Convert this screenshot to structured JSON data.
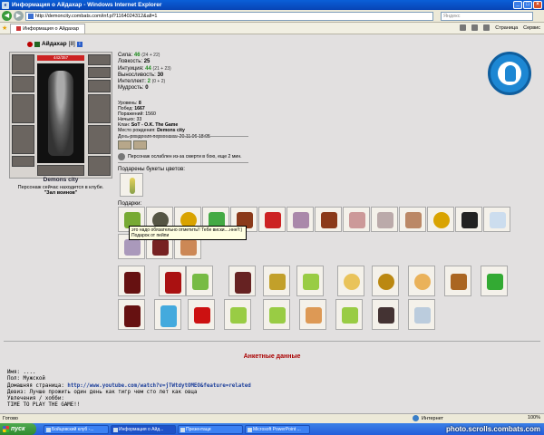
{
  "window": {
    "title": "Информация о Айдахар - Windows Internet Explorer",
    "url": "http://demoncity.combats.com/inf.pl?1164024312&all=1",
    "search_placeholder": "Яндекс",
    "tab_label": "Информация о Айдахар",
    "tools": {
      "page": "Страница",
      "service": "Сервис"
    }
  },
  "character": {
    "name": "Айдахар",
    "level": "[8]",
    "hp": "442/357",
    "city": "Demons city",
    "location_text": "Персонаж сейчас находится в клубе.",
    "location_room": "\"Зал воинов\""
  },
  "stats": {
    "strength_label": "Сила:",
    "strength": "46",
    "strength_extra": "(24 + 22)",
    "agility_label": "Ловкость:",
    "agility": "25",
    "intuition_label": "Интуиция:",
    "intuition": "44",
    "intuition_extra": "(21 + 23)",
    "endurance_label": "Выносливость:",
    "endurance": "30",
    "intellect_label": "Интеллект:",
    "intellect": "2",
    "intellect_extra": "(0 + 2)",
    "wisdom_label": "Мудрость:",
    "wisdom": "0"
  },
  "info": {
    "level_label": "Уровень:",
    "level": "8",
    "wins_label": "Побед:",
    "wins": "1667",
    "losses_label": "Поражений:",
    "losses": "1560",
    "draws_label": "Ничьих:",
    "draws": "33",
    "clan_label": "Клан:",
    "clan": "SoT - O.K. The Game",
    "birthplace_label": "Место рождения:",
    "birthplace": "Demons city",
    "birthday_label": "День рождения персонажа:",
    "birthday": "20.11.06 18:05"
  },
  "weakness": "Персонаж ослаблен из-за смерти в бою, еще 2 мин.",
  "bouquets_title": "Подарены букеты цветов:",
  "gifts_title": "Подарки:",
  "tooltip": {
    "line1": "это надо обязательно отметить!! Тебе виски....ннн!!:)",
    "line2": "Подарок от пейпи"
  },
  "anketa_title": "Анкетные данные",
  "profile": {
    "name_label": "Имя:",
    "name": "....",
    "sex_label": "Пол:",
    "sex": "Мужской",
    "homepage_label": "Домашняя страница:",
    "homepage": "http://www.youtube.com/watch?v=jTWtdytOMEO&feature=related",
    "motto_label": "Девиз:",
    "motto": "Лучше прожить один день как тигр чем сто лет как овца",
    "hobby_label": "Увлечения / хобби:",
    "hobby": "TIME TO PLAY THE GAME!!"
  },
  "statusbar": {
    "left": "Готово",
    "zone": "Интернет",
    "zoom": "100%"
  },
  "taskbar": {
    "start": "пуск",
    "items": [
      "Бойцовский клуб -...",
      "Информация о Айд...",
      "Презентаци",
      "Microsoft PowerPoint ..."
    ],
    "watermark": "photo.scrolls.combats.com"
  },
  "colors": {
    "stat_green": "#1c8a1c",
    "anketa_red": "#aa0000",
    "link_blue": "#1a3d9a",
    "logo_blue": "#1d87d3"
  }
}
